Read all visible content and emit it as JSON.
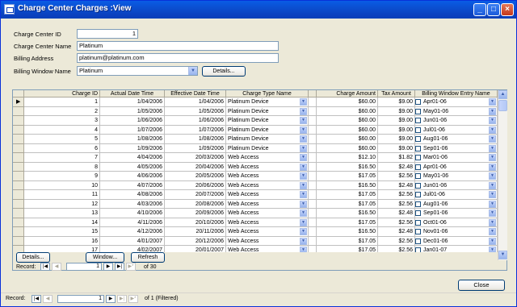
{
  "window": {
    "title": "Charge Center Charges :View"
  },
  "form": {
    "charge_center_id": {
      "label": "Charge Center ID",
      "value": "1"
    },
    "charge_center_name": {
      "label": "Charge Center Name",
      "value": "Platinum"
    },
    "billing_address": {
      "label": "Billing Address",
      "value": "platinum@platinum.com"
    },
    "billing_window_name": {
      "label": "Billing Window Name",
      "value": "Platinum"
    },
    "details_label": "Details..."
  },
  "grid": {
    "columns": [
      "Charge ID",
      "Actual Date Time",
      "Effective Date Time",
      "Charge Type Name",
      "Charge Amount",
      "Tax Amount",
      "Billing Window Entry Name"
    ],
    "rows": [
      [
        "1",
        "1/04/2006",
        "1/04/2006",
        "Platinum Device",
        "$60.00",
        "$9.00",
        "Apr01-06"
      ],
      [
        "2",
        "1/05/2006",
        "1/05/2006",
        "Platinum Device",
        "$60.00",
        "$9.00",
        "May01-06"
      ],
      [
        "3",
        "1/06/2006",
        "1/06/2006",
        "Platinum Device",
        "$60.00",
        "$9.00",
        "Jun01-06"
      ],
      [
        "4",
        "1/07/2006",
        "1/07/2006",
        "Platinum Device",
        "$60.00",
        "$9.00",
        "Jul01-06"
      ],
      [
        "5",
        "1/08/2006",
        "1/08/2006",
        "Platinum Device",
        "$60.00",
        "$9.00",
        "Aug01-06"
      ],
      [
        "6",
        "1/09/2006",
        "1/09/2006",
        "Platinum Device",
        "$60.00",
        "$9.00",
        "Sep01-06"
      ],
      [
        "7",
        "4/04/2006",
        "20/03/2006",
        "Web Access",
        "$12.10",
        "$1.82",
        "Mar01-06"
      ],
      [
        "8",
        "4/05/2006",
        "20/04/2006",
        "Web Access",
        "$16.50",
        "$2.48",
        "Apr01-06"
      ],
      [
        "9",
        "4/06/2006",
        "20/05/2006",
        "Web Access",
        "$17.05",
        "$2.56",
        "May01-06"
      ],
      [
        "10",
        "4/07/2006",
        "20/06/2006",
        "Web Access",
        "$16.50",
        "$2.48",
        "Jun01-06"
      ],
      [
        "11",
        "4/08/2006",
        "20/07/2006",
        "Web Access",
        "$17.05",
        "$2.56",
        "Jul01-06"
      ],
      [
        "12",
        "4/03/2006",
        "20/08/2006",
        "Web Access",
        "$17.05",
        "$2.56",
        "Aug01-06"
      ],
      [
        "13",
        "4/10/2006",
        "20/09/2006",
        "Web Access",
        "$16.50",
        "$2.48",
        "Sep01-06"
      ],
      [
        "14",
        "4/11/2006",
        "20/10/2006",
        "Web Access",
        "$17.05",
        "$2.56",
        "Oct01-06"
      ],
      [
        "15",
        "4/12/2006",
        "20/11/2006",
        "Web Access",
        "$16.50",
        "$2.48",
        "Nov01-06"
      ],
      [
        "16",
        "4/01/2007",
        "20/12/2006",
        "Web Access",
        "$17.05",
        "$2.56",
        "Dec01-06"
      ],
      [
        "17",
        "4/02/2007",
        "20/01/2007",
        "Web Access",
        "$17.05",
        "$2.56",
        "Jan01-07"
      ]
    ]
  },
  "subform_buttons": {
    "details": "Details...",
    "window": "Window...",
    "refresh": "Refresh"
  },
  "sub_nav": {
    "record_label": "Record:",
    "current": "1",
    "of_text": "of  30"
  },
  "close_label": "Close",
  "main_nav": {
    "record_label": "Record:",
    "current": "1",
    "of_text": "of  1 (Filtered)"
  }
}
